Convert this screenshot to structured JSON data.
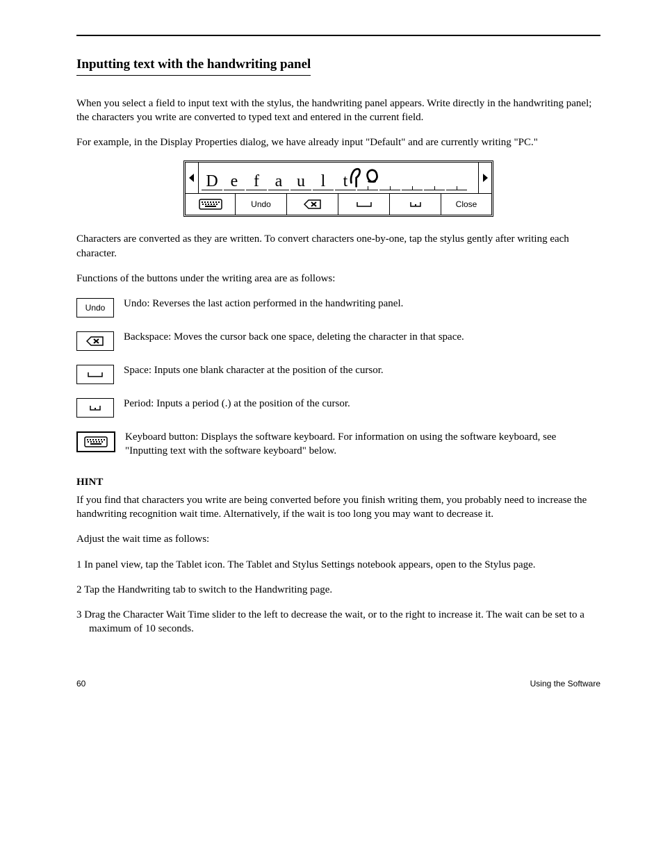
{
  "heading": "Inputting text with the handwriting panel",
  "intro_p1": "When you select a field to input text with the stylus, the handwriting panel appears. Write directly in the handwriting panel; the characters you write are converted to typed text and entered in the current field.",
  "intro_p2": "For example, in the Display Properties dialog, we have already input \"Default\" and are currently writing \"PC.\"",
  "panel": {
    "recognized_chars": [
      "D",
      "e",
      "f",
      "a",
      "u",
      "l",
      "t"
    ],
    "undo_label": "Undo",
    "close_label": "Close"
  },
  "after_panel": "Characters are converted as they are written. To convert characters one-by-one, tap the stylus gently after writing each character.",
  "legend_intro": "Functions of the buttons under the writing area are as follows:",
  "legend": {
    "undo": "Undo: Reverses the last action performed in the handwriting panel.",
    "backspace": "Backspace: Moves the cursor back one space, deleting the character in that space.",
    "space": "Space: Inputs one blank character at the position of the cursor.",
    "period": "Period: Inputs a period (.) at the position of the cursor.",
    "keyboard": "Keyboard button: Displays the software keyboard. For information on using the software keyboard, see \"Inputting text with the software keyboard\" below."
  },
  "hint_heading": "HINT",
  "hint_body": "If you find that characters you write are being converted before you finish writing them, you probably need to increase the handwriting recognition wait time. Alternatively, if the wait is too long you may want to decrease it.",
  "hint_steps_lead": "Adjust the wait time as follows:",
  "hint_step1": "1  In panel view, tap the Tablet icon. The Tablet and Stylus Settings notebook appears, open to the Stylus page.",
  "hint_step2": "2  Tap the Handwriting tab to switch to the Handwriting page.",
  "hint_step3": "3  Drag the Character Wait Time slider to the left to decrease the wait, or to the right to increase it. The wait can be set to a maximum of 10 seconds.",
  "footer_left": "60",
  "footer_right": "Using the Software"
}
